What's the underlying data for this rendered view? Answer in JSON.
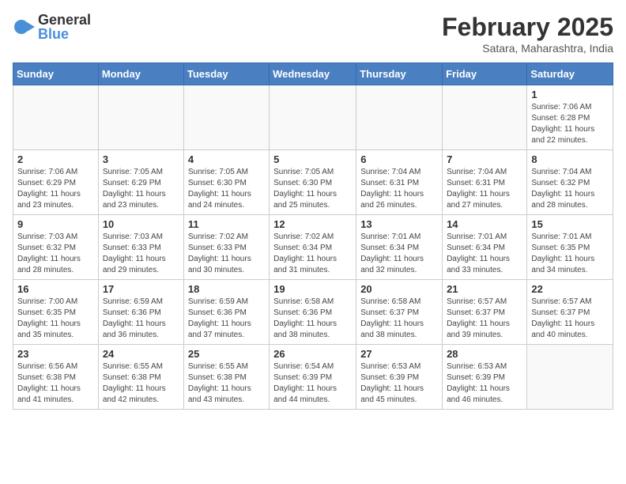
{
  "logo": {
    "general": "General",
    "blue": "Blue"
  },
  "title": "February 2025",
  "subtitle": "Satara, Maharashtra, India",
  "weekdays": [
    "Sunday",
    "Monday",
    "Tuesday",
    "Wednesday",
    "Thursday",
    "Friday",
    "Saturday"
  ],
  "weeks": [
    [
      {
        "day": "",
        "info": ""
      },
      {
        "day": "",
        "info": ""
      },
      {
        "day": "",
        "info": ""
      },
      {
        "day": "",
        "info": ""
      },
      {
        "day": "",
        "info": ""
      },
      {
        "day": "",
        "info": ""
      },
      {
        "day": "1",
        "info": "Sunrise: 7:06 AM\nSunset: 6:28 PM\nDaylight: 11 hours\nand 22 minutes."
      }
    ],
    [
      {
        "day": "2",
        "info": "Sunrise: 7:06 AM\nSunset: 6:29 PM\nDaylight: 11 hours\nand 23 minutes."
      },
      {
        "day": "3",
        "info": "Sunrise: 7:05 AM\nSunset: 6:29 PM\nDaylight: 11 hours\nand 23 minutes."
      },
      {
        "day": "4",
        "info": "Sunrise: 7:05 AM\nSunset: 6:30 PM\nDaylight: 11 hours\nand 24 minutes."
      },
      {
        "day": "5",
        "info": "Sunrise: 7:05 AM\nSunset: 6:30 PM\nDaylight: 11 hours\nand 25 minutes."
      },
      {
        "day": "6",
        "info": "Sunrise: 7:04 AM\nSunset: 6:31 PM\nDaylight: 11 hours\nand 26 minutes."
      },
      {
        "day": "7",
        "info": "Sunrise: 7:04 AM\nSunset: 6:31 PM\nDaylight: 11 hours\nand 27 minutes."
      },
      {
        "day": "8",
        "info": "Sunrise: 7:04 AM\nSunset: 6:32 PM\nDaylight: 11 hours\nand 28 minutes."
      }
    ],
    [
      {
        "day": "9",
        "info": "Sunrise: 7:03 AM\nSunset: 6:32 PM\nDaylight: 11 hours\nand 28 minutes."
      },
      {
        "day": "10",
        "info": "Sunrise: 7:03 AM\nSunset: 6:33 PM\nDaylight: 11 hours\nand 29 minutes."
      },
      {
        "day": "11",
        "info": "Sunrise: 7:02 AM\nSunset: 6:33 PM\nDaylight: 11 hours\nand 30 minutes."
      },
      {
        "day": "12",
        "info": "Sunrise: 7:02 AM\nSunset: 6:34 PM\nDaylight: 11 hours\nand 31 minutes."
      },
      {
        "day": "13",
        "info": "Sunrise: 7:01 AM\nSunset: 6:34 PM\nDaylight: 11 hours\nand 32 minutes."
      },
      {
        "day": "14",
        "info": "Sunrise: 7:01 AM\nSunset: 6:34 PM\nDaylight: 11 hours\nand 33 minutes."
      },
      {
        "day": "15",
        "info": "Sunrise: 7:01 AM\nSunset: 6:35 PM\nDaylight: 11 hours\nand 34 minutes."
      }
    ],
    [
      {
        "day": "16",
        "info": "Sunrise: 7:00 AM\nSunset: 6:35 PM\nDaylight: 11 hours\nand 35 minutes."
      },
      {
        "day": "17",
        "info": "Sunrise: 6:59 AM\nSunset: 6:36 PM\nDaylight: 11 hours\nand 36 minutes."
      },
      {
        "day": "18",
        "info": "Sunrise: 6:59 AM\nSunset: 6:36 PM\nDaylight: 11 hours\nand 37 minutes."
      },
      {
        "day": "19",
        "info": "Sunrise: 6:58 AM\nSunset: 6:36 PM\nDaylight: 11 hours\nand 38 minutes."
      },
      {
        "day": "20",
        "info": "Sunrise: 6:58 AM\nSunset: 6:37 PM\nDaylight: 11 hours\nand 38 minutes."
      },
      {
        "day": "21",
        "info": "Sunrise: 6:57 AM\nSunset: 6:37 PM\nDaylight: 11 hours\nand 39 minutes."
      },
      {
        "day": "22",
        "info": "Sunrise: 6:57 AM\nSunset: 6:37 PM\nDaylight: 11 hours\nand 40 minutes."
      }
    ],
    [
      {
        "day": "23",
        "info": "Sunrise: 6:56 AM\nSunset: 6:38 PM\nDaylight: 11 hours\nand 41 minutes."
      },
      {
        "day": "24",
        "info": "Sunrise: 6:55 AM\nSunset: 6:38 PM\nDaylight: 11 hours\nand 42 minutes."
      },
      {
        "day": "25",
        "info": "Sunrise: 6:55 AM\nSunset: 6:38 PM\nDaylight: 11 hours\nand 43 minutes."
      },
      {
        "day": "26",
        "info": "Sunrise: 6:54 AM\nSunset: 6:39 PM\nDaylight: 11 hours\nand 44 minutes."
      },
      {
        "day": "27",
        "info": "Sunrise: 6:53 AM\nSunset: 6:39 PM\nDaylight: 11 hours\nand 45 minutes."
      },
      {
        "day": "28",
        "info": "Sunrise: 6:53 AM\nSunset: 6:39 PM\nDaylight: 11 hours\nand 46 minutes."
      },
      {
        "day": "",
        "info": ""
      }
    ]
  ]
}
